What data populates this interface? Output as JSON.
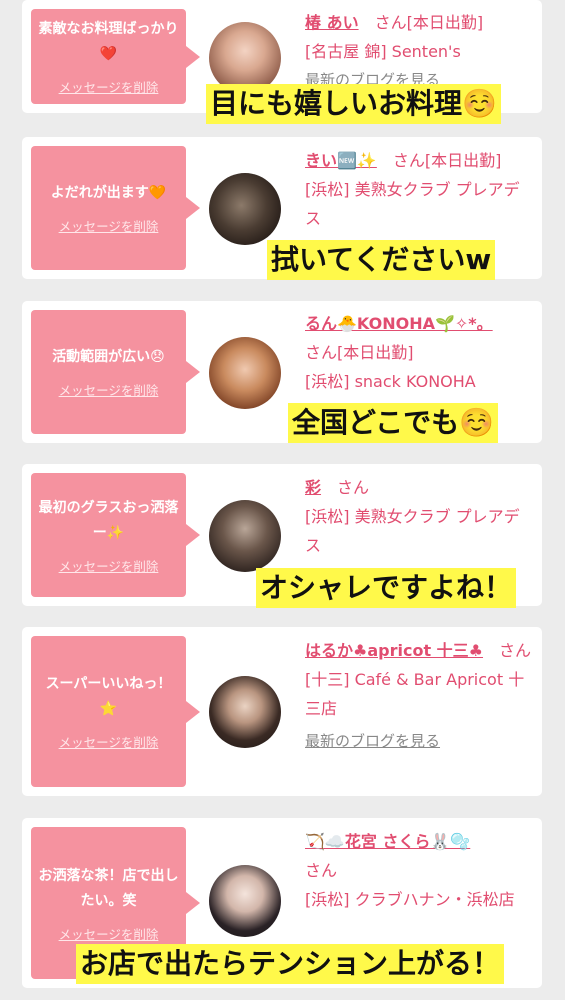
{
  "cards": [
    {
      "message": "素敵なお料理ばっかり❤️",
      "delete_label": "メッセージを削除",
      "name": "椿 あい",
      "san": "さん",
      "status": "[本日出勤]",
      "shop": "[名古屋 錦] Senten's",
      "extra": "最新のブログを見る",
      "overlay": "目にも嬉しいお料理☺️"
    },
    {
      "message": "よだれが出ます🧡",
      "delete_label": "メッセージを削除",
      "name": "きい🆕✨",
      "san": "さん",
      "status": "[本日出勤]",
      "shop": "[浜松] 美熟女クラブ プレアデス",
      "overlay": "拭いてくださいw"
    },
    {
      "message": "活動範囲が広い😞",
      "delete_label": "メッセージを削除",
      "name": "るん🐣KONOHA🌱✧*。",
      "san": "さん",
      "status": "[本日出勤]",
      "shop": "[浜松] snack KONOHA",
      "overlay": "全国どこでも☺️"
    },
    {
      "message": "最初のグラスおっ洒落ー✨",
      "delete_label": "メッセージを削除",
      "name": "彩",
      "san": "さん",
      "shop": "[浜松] 美熟女クラブ プレアデス",
      "overlay": "オシャレですよね！"
    },
    {
      "message": "スーパーいいねっ！⭐",
      "delete_label": "メッセージを削除",
      "name": "はるか♣apricot 十三♣",
      "san": "さん",
      "shop": "[十三] Café & Bar Apricot 十三店",
      "blog": "最新のブログを見る"
    },
    {
      "message": "お洒落な茶！店で出したい。笑",
      "delete_label": "メッセージを削除",
      "name": "🏹☁️花宮 さくら🐰🫧",
      "san": "さん",
      "shop": "[浜松] クラブハナン・浜松店",
      "overlay": "お店で出たらテンション上がる！"
    }
  ]
}
